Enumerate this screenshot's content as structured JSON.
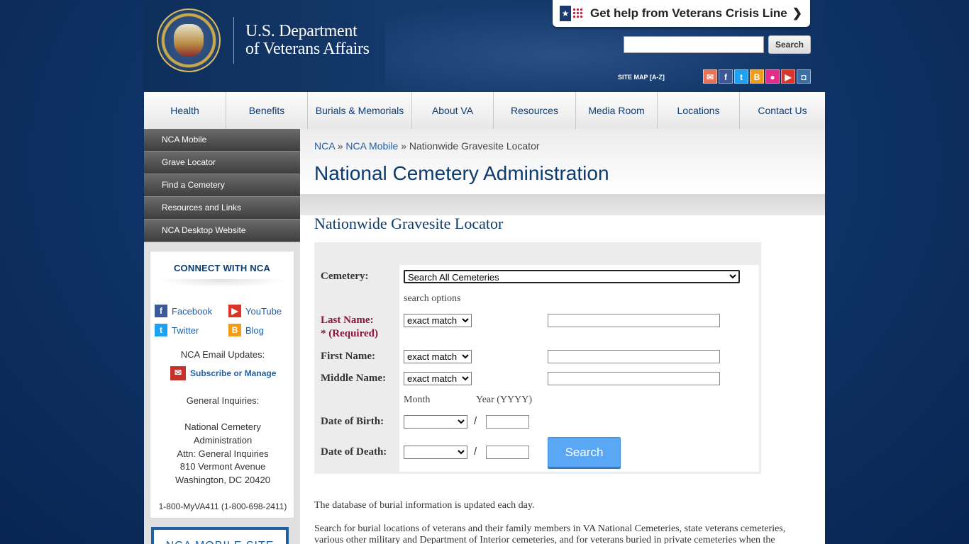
{
  "header": {
    "dept_line1": "U.S. Department",
    "dept_line2": "of Veterans Affairs",
    "crisis_text": "Get help from Veterans Crisis Line",
    "search_button": "Search",
    "sitemap": "SITE MAP [A-Z]",
    "social_icons": [
      "email-icon",
      "facebook-icon",
      "twitter-icon",
      "blog-icon",
      "flickr-icon",
      "youtube-icon",
      "instagram-icon"
    ]
  },
  "nav": [
    "Health",
    "Benefits",
    "Burials & Memorials",
    "About VA",
    "Resources",
    "Media Room",
    "Locations",
    "Contact Us"
  ],
  "sidebar": {
    "items": [
      "NCA Mobile",
      "Grave Locator",
      "Find a Cemetery",
      "Resources and Links",
      "NCA Desktop Website"
    ],
    "connect_title": "CONNECT WITH NCA",
    "facebook": "Facebook",
    "youtube": "YouTube",
    "twitter": "Twitter",
    "blog": "Blog",
    "email_updates": "NCA Email Updates:",
    "subscribe": "Subscribe or Manage",
    "general_inquiries": "General Inquiries:",
    "addr1": "National Cemetery",
    "addr2": "Administration",
    "addr3": "Attn: General Inquiries",
    "addr4": "810 Vermont Avenue",
    "addr5": "Washington, DC 20420",
    "phone": "1-800-MyVA411 (1-800-698-2411)",
    "mobile_site": "NCA MOBILE SITE"
  },
  "main": {
    "crumbs": [
      "NCA",
      "NCA Mobile",
      "Nationwide Gravesite Locator"
    ],
    "crumb_sep": "»",
    "page_title": "National Cemetery Administration",
    "locator_title": "Nationwide Gravesite Locator",
    "form": {
      "cemetery_label": "Cemetery:",
      "cemetery_value": "Search All Cemeteries",
      "search_options": "search options",
      "last_name_label": "Last Name:",
      "required": "* (Required)",
      "first_name_label": "First Name:",
      "middle_name_label": "Middle Name:",
      "match_value": "exact match",
      "month": "Month",
      "year": "Year (YYYY)",
      "dob_label": "Date of Birth:",
      "dod_label": "Date of Death:",
      "slash": "/",
      "search_button": "Search"
    },
    "para1": "The database of burial information is updated each day.",
    "para2": "Search for burial locations of veterans and their family members in VA National Cemeteries, state veterans cemeteries, various other military and Department of Interior cemeteries, and for veterans buried in private cemeteries when the"
  }
}
